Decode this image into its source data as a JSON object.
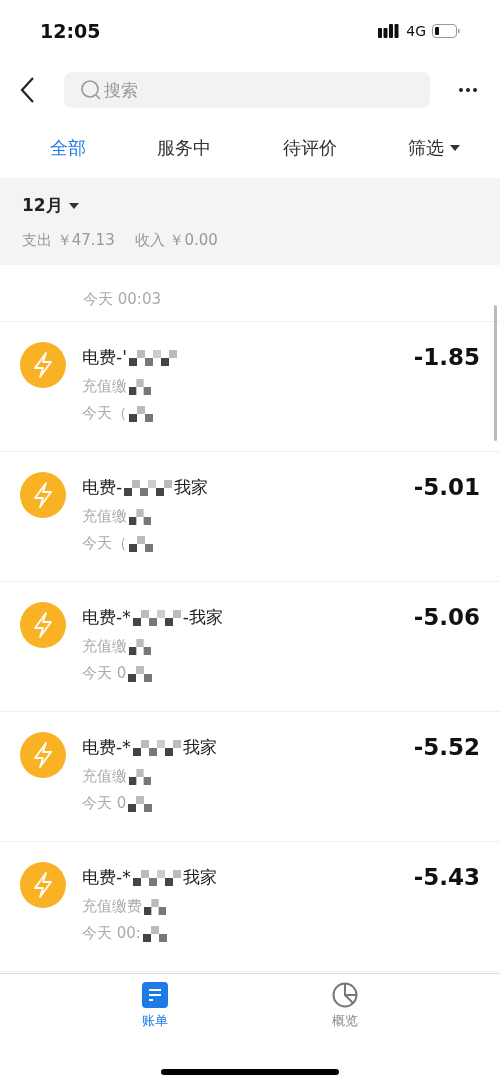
{
  "status_bar": {
    "time": "12:05",
    "network": "4G"
  },
  "header": {
    "search": {
      "placeholder": "搜索"
    }
  },
  "tabs": [
    {
      "label": "全部",
      "selected": true,
      "kind": "plain"
    },
    {
      "label": "服务中",
      "selected": false,
      "kind": "plain"
    },
    {
      "label": "待评价",
      "selected": false,
      "kind": "plain"
    },
    {
      "label": "筛选",
      "selected": false,
      "kind": "dropdown"
    }
  ],
  "summary": {
    "month": "12月",
    "expense": "支出 ￥47.13",
    "income": "收入 ￥0.00"
  },
  "records": [
    {
      "kind": "partial",
      "time": "今天 00:03"
    },
    {
      "kind": "full",
      "title_start": "电费-'",
      "subtitle": "充值缴",
      "time": "今天（",
      "amount": "-1.85"
    },
    {
      "kind": "full",
      "title_start": "电费-",
      "title_end": "我家",
      "subtitle": "充值缴",
      "time": "今天（",
      "amount": "-5.01"
    },
    {
      "kind": "full",
      "title_start": "电费-*",
      "title_end": "-我家",
      "subtitle": "充值缴",
      "time": "今天 0",
      "amount": "-5.06"
    },
    {
      "kind": "full",
      "title_start": "电费-*",
      "title_end": "我家",
      "subtitle": "充值缴",
      "time": "今天 0",
      "amount": "-5.52"
    },
    {
      "kind": "full",
      "title_start": "电费-*",
      "title_end": "我家",
      "subtitle": "充值缴费",
      "time": "今天 00:",
      "amount": "-5.43"
    }
  ],
  "bottom_nav": [
    {
      "label": "账单",
      "selected": true,
      "kind": "bill"
    },
    {
      "label": "概览",
      "selected": false,
      "kind": "overview"
    }
  ]
}
